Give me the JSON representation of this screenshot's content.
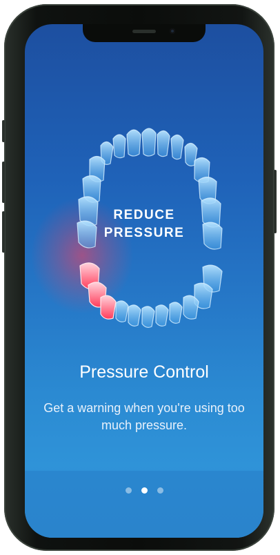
{
  "screen": {
    "illustration_label_line1": "REDUCE",
    "illustration_label_line2": "PRESSURE",
    "title": "Pressure Control",
    "description": "Get a warning when you're using too much pressure."
  },
  "pager": {
    "count": 3,
    "active_index": 1
  },
  "colors": {
    "background_top": "#1d4fa0",
    "background_bottom": "#2f93d8",
    "highlight": "#ff3c5a",
    "teeth": "#8fd0ff"
  },
  "icons": {
    "illustration": "teeth-arch-icon"
  }
}
